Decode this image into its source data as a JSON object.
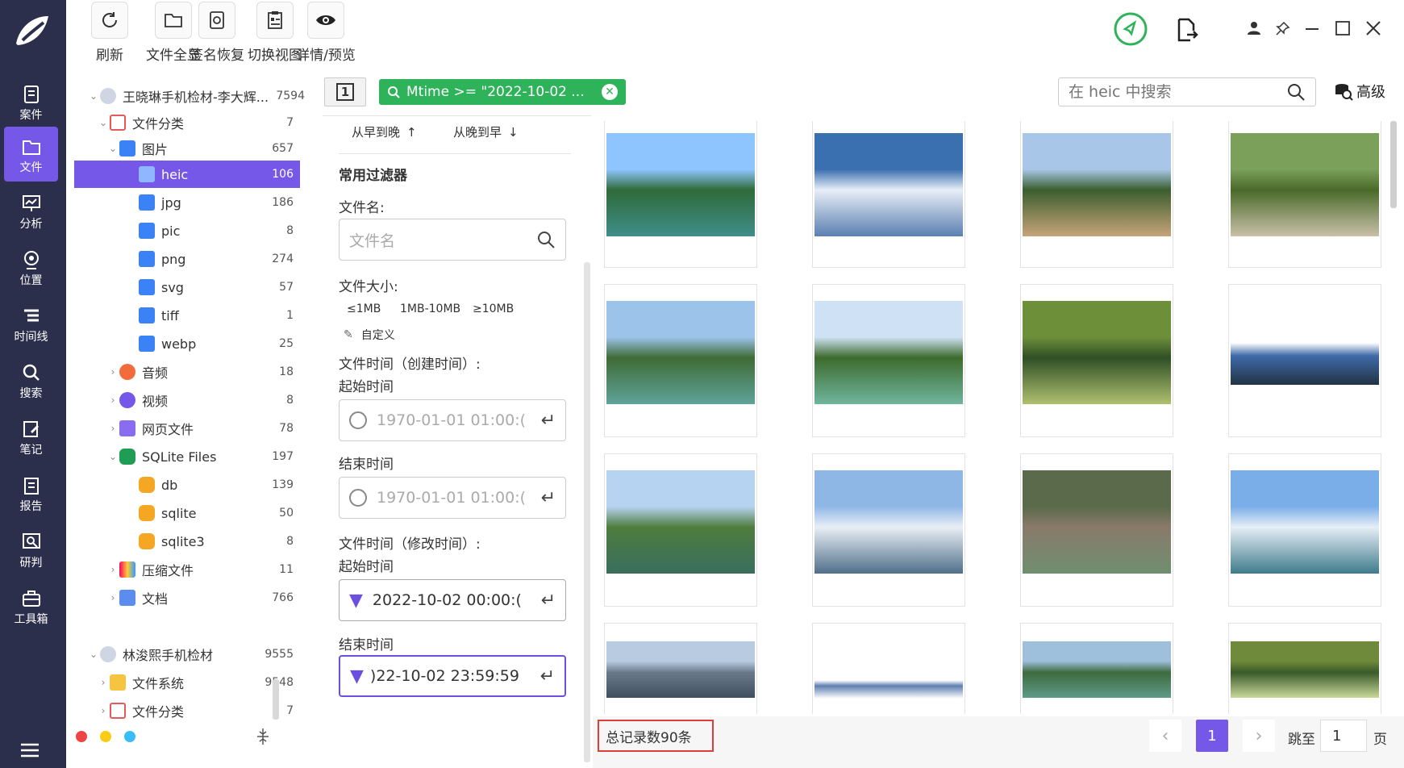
{
  "sidebar": {
    "items": [
      {
        "label": "案件",
        "icon": "case-icon"
      },
      {
        "label": "文件",
        "icon": "file-icon",
        "active": true
      },
      {
        "label": "分析",
        "icon": "analysis-icon"
      },
      {
        "label": "位置",
        "icon": "location-icon"
      },
      {
        "label": "时间线",
        "icon": "timeline-icon"
      },
      {
        "label": "搜索",
        "icon": "search-icon"
      },
      {
        "label": "笔记",
        "icon": "note-icon"
      },
      {
        "label": "报告",
        "icon": "report-icon"
      },
      {
        "label": "研判",
        "icon": "judge-icon"
      },
      {
        "label": "工具箱",
        "icon": "toolbox-icon"
      }
    ]
  },
  "toolbar": {
    "refresh": "刷新",
    "show_all": "文件全显",
    "sig_restore": "签名恢复",
    "switch_view": "切换视图",
    "detail_preview": "详情/预览"
  },
  "tree": {
    "case1": {
      "label": "王晓琳手机检材-李大辉...",
      "count": "7594"
    },
    "file_category": {
      "label": "文件分类",
      "count": "7"
    },
    "pictures": {
      "label": "图片",
      "count": "657"
    },
    "heic": {
      "label": "heic",
      "count": "106"
    },
    "jpg": {
      "label": "jpg",
      "count": "186"
    },
    "pic": {
      "label": "pic",
      "count": "8"
    },
    "png": {
      "label": "png",
      "count": "274"
    },
    "svg": {
      "label": "svg",
      "count": "57"
    },
    "tiff": {
      "label": "tiff",
      "count": "1"
    },
    "webp": {
      "label": "webp",
      "count": "25"
    },
    "audio": {
      "label": "音频",
      "count": "18"
    },
    "video": {
      "label": "视频",
      "count": "8"
    },
    "web": {
      "label": "网页文件",
      "count": "78"
    },
    "sqlite": {
      "label": "SQLite Files",
      "count": "197"
    },
    "db": {
      "label": "db",
      "count": "139"
    },
    "sqlite_ext": {
      "label": "sqlite",
      "count": "50"
    },
    "sqlite3": {
      "label": "sqlite3",
      "count": "8"
    },
    "archive": {
      "label": "压缩文件",
      "count": "11"
    },
    "docs": {
      "label": "文档",
      "count": "766"
    },
    "case2": {
      "label": "林浚熙手机检材",
      "count": "9555"
    },
    "filesystem": {
      "label": "文件系统",
      "count": "9548"
    },
    "file_category2": {
      "label": "文件分类",
      "count": "7"
    }
  },
  "filter_tag": {
    "text": "Mtime >= \"2022-10-02 ...",
    "page_num": "1"
  },
  "search": {
    "placeholder": "在 heic 中搜索",
    "advanced": "高级"
  },
  "filters": {
    "sort_asc": "从早到晚",
    "sort_desc": "从晚到早",
    "common": "常用过滤器",
    "filename_label": "文件名:",
    "filename_placeholder": "文件名",
    "size_label": "文件大小:",
    "size_opts": [
      "≤1MB",
      "1MB-10MB",
      "≥10MB"
    ],
    "custom": "自定义",
    "ctime_label": "文件时间（创建时间）:",
    "start_label": "起始时间",
    "end_label": "结束时间",
    "ctime_start": "1970-01-01 01:00:(",
    "ctime_end": "1970-01-01 01:00:(",
    "mtime_label": "文件时间（修改时间）:",
    "mtime_start_label": "起始时间",
    "mtime_end_label": "结束时间",
    "mtime_start": "2022-10-02 00:00:(",
    "mtime_end": ")22-10-02 23:59:59"
  },
  "footer": {
    "total": "总记录数90条",
    "current_page": "1",
    "jump_label": "跳至",
    "jump_value": "1",
    "page_unit": "页"
  },
  "colors": {
    "accent": "#7658e8",
    "sidebar": "#2b2f4c",
    "tag_green": "#2fb35a"
  }
}
